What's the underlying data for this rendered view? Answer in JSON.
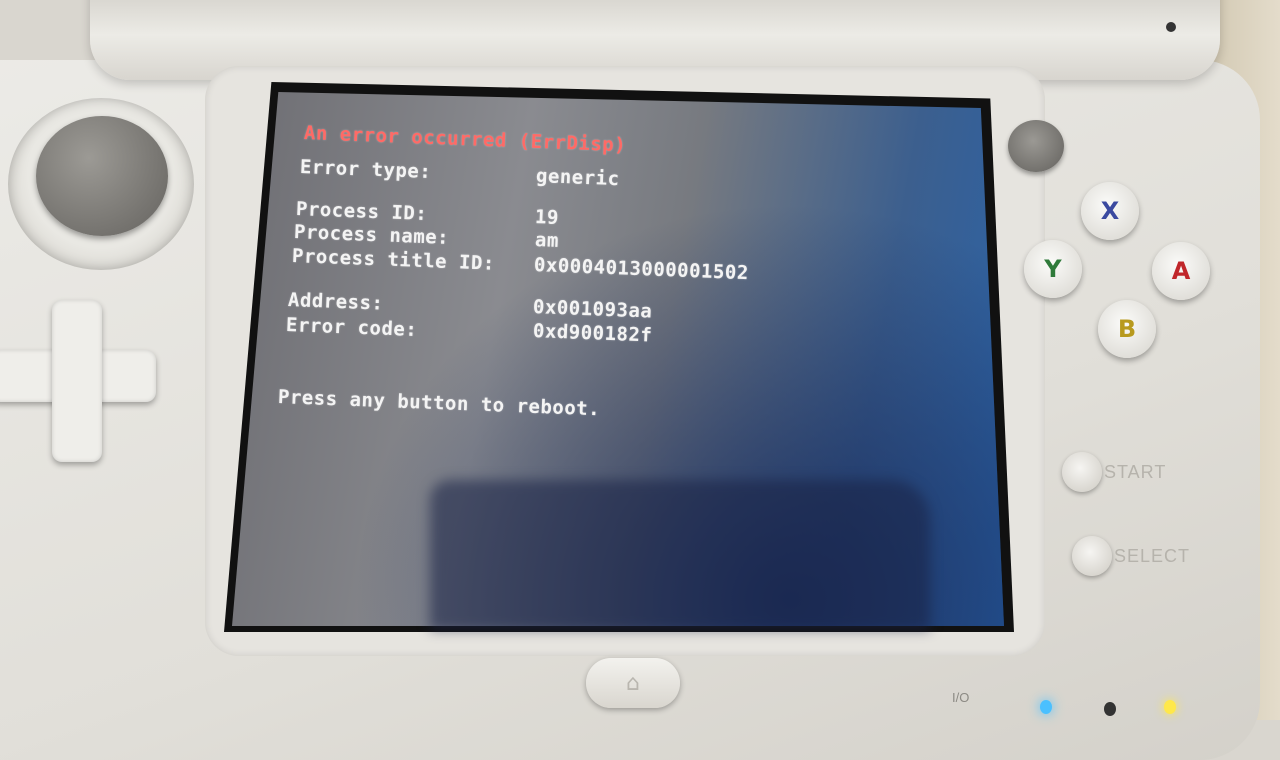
{
  "error_screen": {
    "title": "An error occurred (ErrDisp)",
    "lines": [
      {
        "label": "Error type:",
        "value": "generic"
      },
      {
        "label": "Process ID:",
        "value": "19"
      },
      {
        "label": "Process name:",
        "value": "am"
      },
      {
        "label": "Process title ID:",
        "value": "0x0004013000001502"
      },
      {
        "label": "Address:",
        "value": "0x001093aa"
      },
      {
        "label": "Error code:",
        "value": "0xd900182f"
      }
    ],
    "prompt": "Press any button to reboot."
  },
  "controls": {
    "face_buttons": [
      {
        "label": "X",
        "color": "#3b4aa0"
      },
      {
        "label": "Y",
        "color": "#2f7a3a"
      },
      {
        "label": "A",
        "color": "#c0262a"
      },
      {
        "label": "B",
        "color": "#b89a1e"
      }
    ],
    "start_label": "START",
    "select_label": "SELECT",
    "home_icon": "home-icon",
    "io_label": "I/O"
  },
  "colors": {
    "title_text": "#ff6a66",
    "body_text": "#f4f4f4",
    "led_blue": "#4ac0ff",
    "led_yellow": "#ffe84a"
  }
}
